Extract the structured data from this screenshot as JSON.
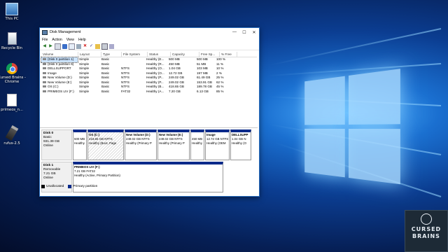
{
  "desktop": {
    "icons": [
      {
        "name": "This PC",
        "icon": "computer-icon"
      },
      {
        "name": "Recycle Bin",
        "icon": "recycle-bin-icon"
      },
      {
        "name": "Cursed Brains - Chrome",
        "icon": "chrome-icon"
      },
      {
        "name": "primeos_n...",
        "icon": "file-icon"
      },
      {
        "name": "rufus-2.5",
        "icon": "usb-icon"
      }
    ],
    "badge": {
      "line1": "CURSED",
      "line2": "BRAINS"
    }
  },
  "window": {
    "title": "Disk Management",
    "menu": [
      "File",
      "Action",
      "View",
      "Help"
    ],
    "controls": {
      "minimize": "—",
      "maximize": "☐",
      "close": "✕"
    }
  },
  "volumes": {
    "columns": [
      "Volume",
      "Layout",
      "Type",
      "File System",
      "Status",
      "Capacity",
      "Free Sp...",
      "% Free"
    ],
    "rows": [
      [
        "(Disk 0 partition 1)",
        "Simple",
        "Basic",
        "",
        "Healthy (E...",
        "500 MB",
        "500 MB",
        "100 %"
      ],
      [
        "(Disk 0 partition 6)",
        "Simple",
        "Basic",
        "",
        "Healthy (R...",
        "450 MB",
        "51 MB",
        "11 %"
      ],
      [
        "DELLSUPPORT",
        "Simple",
        "Basic",
        "NTFS",
        "Healthy (O...",
        "1.04 GB",
        "103 MB",
        "10 %"
      ],
      [
        "Image",
        "Simple",
        "Basic",
        "NTFS",
        "Healthy (O...",
        "12.72 GB",
        "197 MB",
        "2 %"
      ],
      [
        "New Volume (D:)",
        "Simple",
        "Basic",
        "NTFS",
        "Healthy (P...",
        "249.02 GB",
        "61.49 GB",
        "25 %"
      ],
      [
        "New Volume (E:)",
        "Simple",
        "Basic",
        "NTFS",
        "Healthy (P...",
        "249.02 GB",
        "153.91 GB",
        "62 %"
      ],
      [
        "OS (C:)",
        "Simple",
        "Basic",
        "NTFS",
        "Healthy (B...",
        "418.65 GB",
        "189.78 GB",
        "45 %"
      ],
      [
        "PRIMEOS LIV (F:)",
        "Simple",
        "Basic",
        "FAT32",
        "Healthy (A...",
        "7.20 GB",
        "6.13 GB",
        "85 %"
      ]
    ]
  },
  "disks": [
    {
      "name": "Disk 0",
      "type": "Basic",
      "size": "931.39 GB",
      "status": "Online",
      "partitions": [
        {
          "title": "",
          "l2": "500 MB",
          "l3": "Healthy",
          "hatched": false
        },
        {
          "title": "OS  (C:)",
          "l2": "418.65 GB NTFS",
          "l3": "Healthy (Boot, Page",
          "hatched": true
        },
        {
          "title": "New Volume  (D:)",
          "l2": "249.02 GB NTFS",
          "l3": "Healthy (Primary P",
          "hatched": false
        },
        {
          "title": "New Volume  (E:)",
          "l2": "249.02 GB NTFS",
          "l3": "Healthy (Primary P",
          "hatched": false
        },
        {
          "title": "",
          "l2": "450 MB",
          "l3": "Healthy",
          "hatched": false
        },
        {
          "title": "Image",
          "l2": "12.72 GB NTFS",
          "l3": "Healthy (OEM",
          "hatched": false
        },
        {
          "title": "DELLSUPP",
          "l2": "1.04 GB N",
          "l3": "Healthy (O",
          "hatched": false
        }
      ]
    },
    {
      "name": "Disk 1",
      "type": "Removable",
      "size": "7.21 GB",
      "status": "Online",
      "partitions": [
        {
          "title": "PRIMEOS LIV  (F:)",
          "l2": "7.21 GB FAT32",
          "l3": "Healthy (Active, Primary Partition)",
          "hatched": false
        }
      ]
    }
  ],
  "legend": {
    "unallocated": "Unallocated",
    "primary": "Primary partition"
  },
  "colors": {
    "primary": "#0a2a8a",
    "unallocated": "#000000"
  }
}
